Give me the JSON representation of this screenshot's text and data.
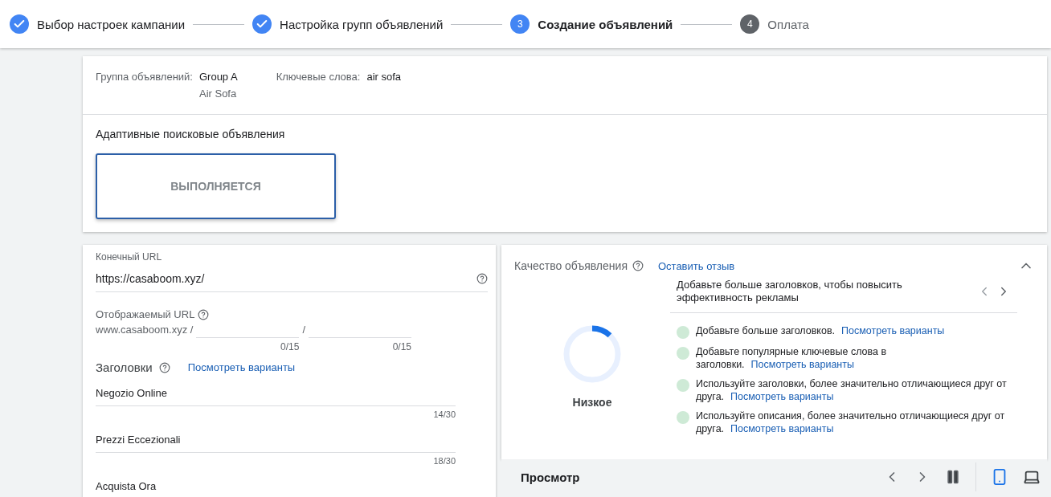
{
  "stepper": [
    {
      "label": "Выбор настроек кампании",
      "kind": "done"
    },
    {
      "label": "Настройка групп объявлений",
      "kind": "done"
    },
    {
      "label": "Создание объявлений",
      "kind": "current",
      "number": "3"
    },
    {
      "label": "Оплата",
      "kind": "upcoming",
      "number": "4"
    }
  ],
  "summary": {
    "group_label": "Группа объявлений:",
    "group_name": "Group A",
    "group_sub": "Air Sofa",
    "keywords_label": "Ключевые слова:",
    "keywords": "air sofa"
  },
  "ad_type": {
    "title": "Адаптивные поисковые объявления",
    "card_status": "ВЫПОЛНЯЕТСЯ"
  },
  "final_url": {
    "label": "Конечный URL",
    "value": "https://casaboom.xyz/"
  },
  "display_url": {
    "label": "Отображаемый URL",
    "domain": "www.casaboom.xyz /",
    "separator": "/",
    "paths": [
      {
        "counter": "0/15"
      },
      {
        "counter": "0/15"
      }
    ]
  },
  "headlines": {
    "title": "Заголовки",
    "link": "Посмотреть варианты",
    "items": [
      {
        "value": "Negozio Online",
        "counter": "14/30"
      },
      {
        "value": "Prezzi Eccezionali",
        "counter": "18/30"
      },
      {
        "value": "Acquista Ora"
      }
    ]
  },
  "quality": {
    "title": "Качество объявления",
    "feedback_link": "Оставить отзыв",
    "expanded": true,
    "level": 0.12,
    "rating": "Низкое",
    "tip": "Добавьте больше заголовков, чтобы повысить эффективность рекламы",
    "suggestions": [
      {
        "text": "Добавьте больше заголовков.",
        "link": "Посмотреть варианты",
        "color": "#ceead6"
      },
      {
        "text": "Добавьте популярные ключевые слова в заголовки.",
        "link": "Посмотреть варианты",
        "color": "#ceead6"
      },
      {
        "text": "Используйте заголовки, более значительно отличающиеся друг от друга.",
        "link": "Посмотреть варианты",
        "color": "#ceead6"
      },
      {
        "text": "Используйте описания, более значительно отличающиеся друг от друга.",
        "link": "Посмотреть варианты",
        "color": "#ceead6"
      }
    ]
  },
  "preview": {
    "title": "Просмотр",
    "devices": [
      {
        "kind": "mobile",
        "selected": true
      },
      {
        "kind": "desktop",
        "selected": false
      }
    ]
  }
}
